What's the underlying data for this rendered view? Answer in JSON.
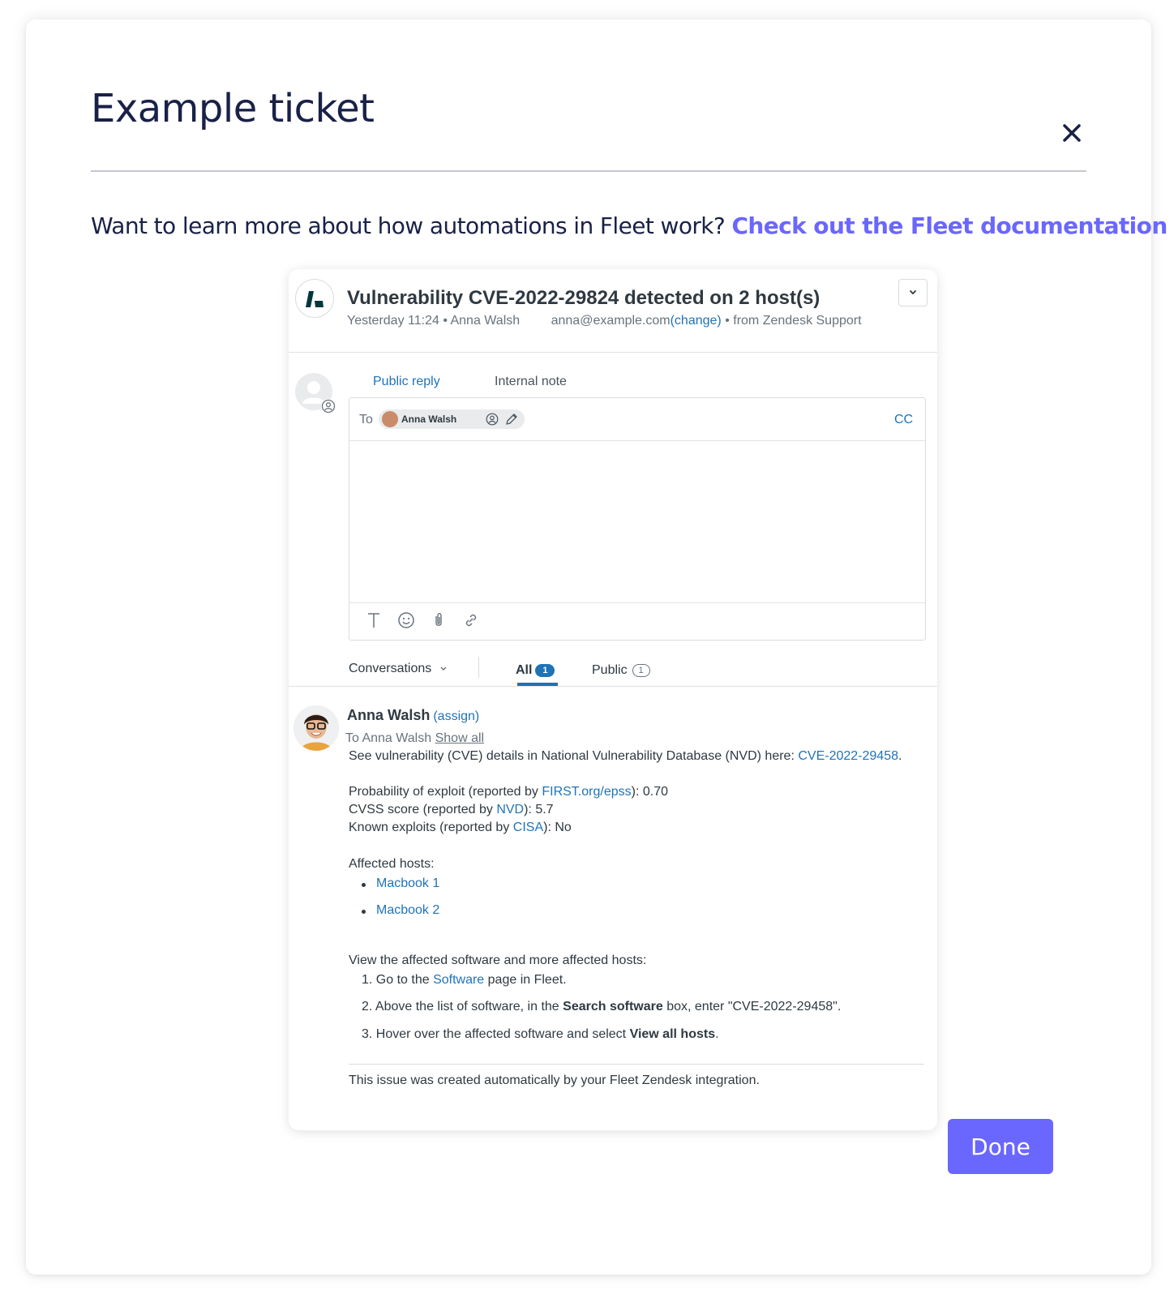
{
  "modal": {
    "title": "Example ticket",
    "intro_text": "Want to learn more about how automations in Fleet work?",
    "doc_link": "Check out the Fleet documentation",
    "done_label": "Done"
  },
  "ticket": {
    "subject": "Vulnerability CVE-2022-29824 detected on 2 host(s)",
    "meta_time": "Yesterday 11:24",
    "meta_author": "Anna Walsh",
    "meta_email": "anna@example.com",
    "meta_change": "(change)",
    "meta_source": "from Zendesk Support",
    "tabs": {
      "public_reply": "Public reply",
      "internal_note": "Internal note"
    },
    "composer": {
      "to_label": "To",
      "recipient": "Anna Walsh",
      "cc_label": "CC"
    },
    "filter": {
      "conversations": "Conversations",
      "all_label": "All",
      "all_count": "1",
      "public_label": "Public",
      "public_count": "1"
    },
    "message": {
      "author": "Anna Walsh",
      "assign": "(assign)",
      "to_text": "To Anna Walsh",
      "show_all": "Show all",
      "line1_prefix": "See vulnerability (CVE) details in National Vulnerability Database (NVD) here:",
      "line1_link": "CVE-2022-29458",
      "line1_suffix": ".",
      "prob_prefix": "Probability of exploit (reported by",
      "prob_link": "FIRST.org/epss",
      "prob_suffix": "): 0.70",
      "cvss_prefix": "CVSS score (reported by",
      "cvss_link": "NVD",
      "cvss_suffix": "): 5.7",
      "known_prefix": "Known exploits (reported by",
      "known_link": "CISA",
      "known_suffix": "): No",
      "affected_label": "Affected hosts:",
      "hosts": [
        "Macbook 1",
        "Macbook 2"
      ],
      "view_label": "View the affected software and more affected hosts:",
      "step1_prefix": "1. Go to the",
      "step1_link": "Software",
      "step1_suffix": "page in Fleet.",
      "step2_prefix": "2. Above the list of software, in the",
      "step2_bold": "Search software",
      "step2_suffix": "box, enter \"CVE-2022-29458\".",
      "step3_prefix": "3. Hover over the affected software and select",
      "step3_bold": "View all hosts",
      "step3_suffix": ".",
      "footer": "This issue was created automatically by your Fleet Zendesk integration."
    }
  },
  "colors": {
    "brand": "#6a67fe",
    "navy": "#192147",
    "zendesk_link": "#1f73b7"
  },
  "icons": [
    "close-icon",
    "external-link-icon",
    "zendesk-logo",
    "chevron-down-icon",
    "agent-avatar-icon",
    "edit-icon",
    "text-format-icon",
    "emoji-icon",
    "attachment-icon",
    "link-icon"
  ]
}
